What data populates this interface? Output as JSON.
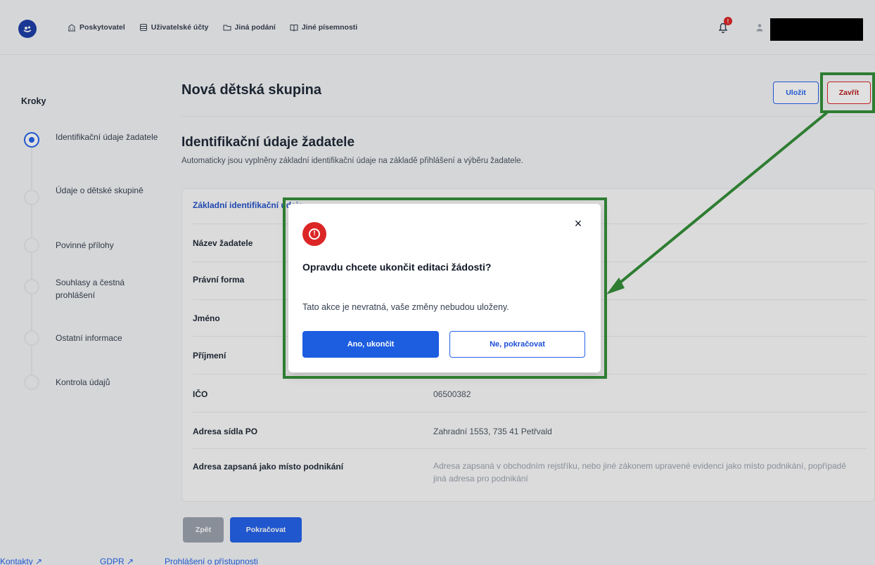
{
  "header": {
    "logo_icon": "rocking-horse-icon",
    "nav": [
      {
        "label": "Poskytovatel",
        "icon": "building-icon"
      },
      {
        "label": "Uživatelské účty",
        "icon": "database-icon"
      },
      {
        "label": "Jiná podání",
        "icon": "folder-icon"
      },
      {
        "label": "Jiné písemnosti",
        "icon": "book-icon"
      }
    ],
    "notification_count": "!",
    "user_name_redacted": true
  },
  "sidebar": {
    "title": "Kroky",
    "steps": [
      {
        "label": "Identifikační údaje žadatele",
        "active": true
      },
      {
        "label": "Údaje o dětské skupině",
        "active": false
      },
      {
        "label": "Povinné přílohy",
        "active": false
      },
      {
        "label": "Souhlasy a čestná prohlášení",
        "active": false
      },
      {
        "label": "Ostatní informace",
        "active": false
      },
      {
        "label": "Kontrola údajů",
        "active": false
      }
    ]
  },
  "main": {
    "page_title": "Nová dětská skupina",
    "save_label": "Uložit",
    "close_label": "Zavřít",
    "section_title": "Identifikační údaje žadatele",
    "section_subtitle": "Automaticky jsou vyplněny základní identifikační údaje na základě přihlášení a výběru žadatele.",
    "card_heading": "Základní identifikační údaje",
    "rows": [
      {
        "label": "Název žadatele",
        "value": ""
      },
      {
        "label": "Právní forma",
        "value": ""
      },
      {
        "label": "Jméno",
        "value": ""
      },
      {
        "label": "Příjmení",
        "value": ""
      },
      {
        "label": "IČO",
        "value": "06500382"
      },
      {
        "label": "Adresa sídla PO",
        "value": "Zahradní 1553, 735  41 Petřvald"
      },
      {
        "label": "Adresa zapsaná jako místo podnikání",
        "value": "Adresa zapsaná v obchodním rejstříku, nebo jiné zákonem upravené evidenci jako místo podnikání, popřípadě jiná adresa pro podnikání"
      }
    ],
    "back_label": "Zpět",
    "next_label": "Pokračovat"
  },
  "footer": {
    "links": [
      "Kontakty ↗",
      "GDPR ↗",
      "Prohlášení o přístupnosti"
    ]
  },
  "modal": {
    "title": "Opravdu chcete ukončit editaci žádosti?",
    "text": "Tato akce je nevratná, vaše změny nebudou uloženy.",
    "confirm_label": "Ano, ukončit",
    "cancel_label": "Ne, pokračovat",
    "close_symbol": "×",
    "alert_symbol": "!"
  },
  "colors": {
    "primary": "#2563eb",
    "danger": "#dc2626",
    "annotation": "#2e7d32"
  }
}
